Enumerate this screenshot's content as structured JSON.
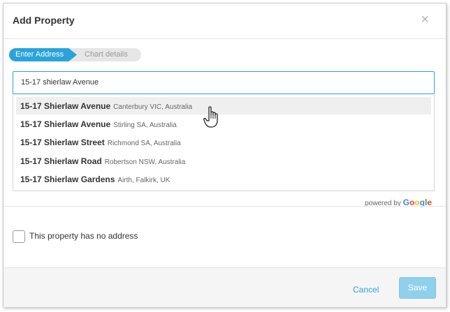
{
  "dialog": {
    "title": "Add Property",
    "close_glyph": "×"
  },
  "steps": [
    {
      "label": "Enter Address",
      "active": true
    },
    {
      "label": "Chart details",
      "active": false
    }
  ],
  "search": {
    "value": "15-17 shierlaw Avenue"
  },
  "suggestions": [
    {
      "main": "15-17 Shierlaw Avenue",
      "secondary": "Canterbury VIC, Australia",
      "hovered": true
    },
    {
      "main": "15-17 Shierlaw Avenue",
      "secondary": "Stirling SA, Australia",
      "hovered": false
    },
    {
      "main": "15-17 Shierlaw Street",
      "secondary": "Richmond SA, Australia",
      "hovered": false
    },
    {
      "main": "15-17 Shierlaw Road",
      "secondary": "Robertson NSW, Australia",
      "hovered": false
    },
    {
      "main": "15-17 Shierlaw Gardens",
      "secondary": "Airth, Falkirk, UK",
      "hovered": false
    }
  ],
  "powered_by": {
    "prefix": "powered by",
    "brand_letters": [
      "G",
      "o",
      "o",
      "g",
      "l",
      "e"
    ],
    "brand_colors": [
      "#4285F4",
      "#EA4335",
      "#FBBC05",
      "#4285F4",
      "#34A853",
      "#EA4335"
    ]
  },
  "no_address": {
    "label": "This property has no address",
    "checked": false
  },
  "footer": {
    "cancel_label": "Cancel",
    "save_label": "Save"
  },
  "colors": {
    "accent": "#2aa3db",
    "save_disabled": "#8fd0ec"
  }
}
